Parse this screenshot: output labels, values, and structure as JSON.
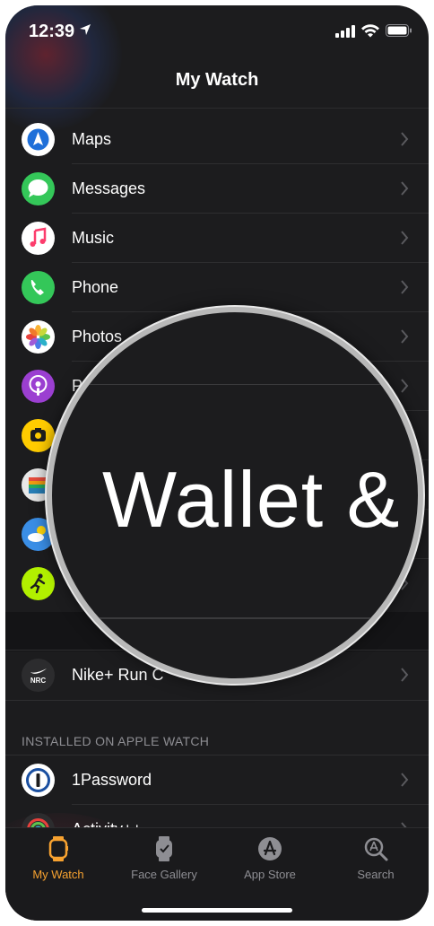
{
  "status_bar": {
    "time": "12:39"
  },
  "nav": {
    "title": "My Watch"
  },
  "apps": [
    {
      "label": "Maps",
      "icon": "maps-icon",
      "bg": "#ffffff"
    },
    {
      "label": "Messages",
      "icon": "messages-icon",
      "bg": "#34c759"
    },
    {
      "label": "Music",
      "icon": "music-icon",
      "bg": "#ffffff"
    },
    {
      "label": "Phone",
      "icon": "phone-icon",
      "bg": "#34c759"
    },
    {
      "label": "Photos",
      "icon": "photos-icon",
      "bg": "#ffffff"
    },
    {
      "label": "P",
      "icon": "podcasts-icon",
      "bg": "#9b3fd1"
    },
    {
      "label": "",
      "icon": "remote-camera-icon",
      "bg": "#ffcc00"
    },
    {
      "label": "",
      "icon": "wallet-icon",
      "bg": "#e8e8e8"
    },
    {
      "label": "",
      "icon": "weather-icon",
      "bg": "#3a8ee6"
    },
    {
      "label": "",
      "icon": "workout-icon",
      "bg": "#b2f000"
    }
  ],
  "third_party": {
    "label": "Nike+ Run C",
    "icon": "nike-run-club-icon",
    "icon_text": "NRC"
  },
  "installed": {
    "header": "INSTALLED ON APPLE WATCH",
    "items": [
      {
        "label": "1Password",
        "icon": "onepassword-icon"
      },
      {
        "label": "Activity++",
        "icon": "activity-icon"
      }
    ]
  },
  "magnifier": {
    "text": "Wallet &"
  },
  "tabs": [
    {
      "label": "My Watch",
      "icon": "watch-icon",
      "active": true
    },
    {
      "label": "Face Gallery",
      "icon": "face-gallery-icon",
      "active": false
    },
    {
      "label": "App Store",
      "icon": "app-store-icon",
      "active": false
    },
    {
      "label": "Search",
      "icon": "search-icon",
      "active": false
    }
  ],
  "colors": {
    "accent": "#f7a230",
    "background": "#1c1c1e",
    "separator": "#2e2e30"
  }
}
